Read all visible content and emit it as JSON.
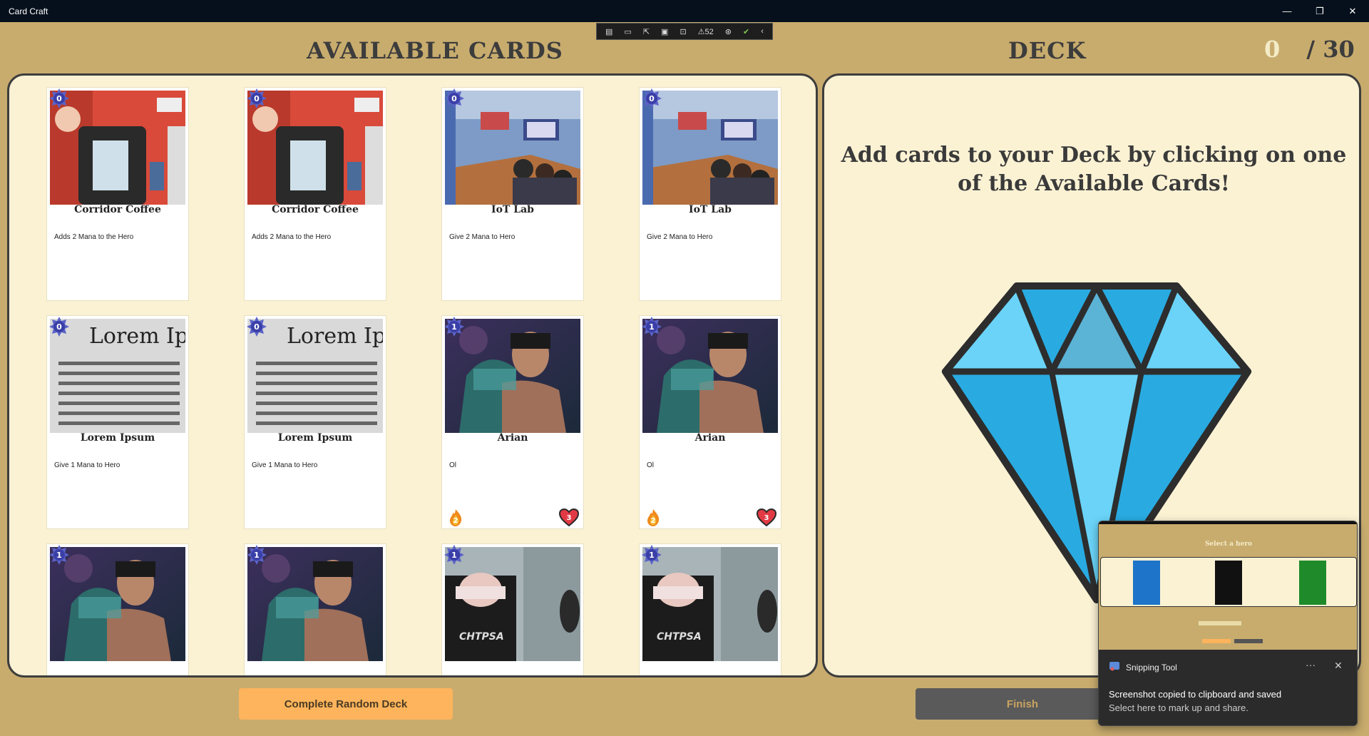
{
  "window": {
    "title": "Card Craft",
    "minimize_icon": "—",
    "restore_icon": "❐",
    "close_icon": "✕"
  },
  "devtools": {
    "counter": "52"
  },
  "available": {
    "title": "AVAILABLE CARDS"
  },
  "deck": {
    "title": "DECK",
    "count_current": "0",
    "count_separator": "/",
    "count_max": "30",
    "empty_message": "Add cards to your Deck by clicking on one of the Available Cards!"
  },
  "cards": [
    {
      "name": "Corridor Coffee",
      "desc": "Adds 2 Mana to the Hero",
      "cost": "0",
      "art": "coffee"
    },
    {
      "name": "Corridor Coffee",
      "desc": "Adds 2 Mana to the Hero",
      "cost": "0",
      "art": "coffee"
    },
    {
      "name": "IoT Lab",
      "desc": "Give 2 Mana to Hero",
      "cost": "0",
      "art": "lab"
    },
    {
      "name": "IoT Lab",
      "desc": "Give 2 Mana to Hero",
      "cost": "0",
      "art": "lab"
    },
    {
      "name": "Lorem Ipsum",
      "desc": "Give 1 Mana to Hero",
      "cost": "0",
      "art": "lorem",
      "art_heading": "Lorem Ips"
    },
    {
      "name": "Lorem Ipsum",
      "desc": "Give 1 Mana to Hero",
      "cost": "0",
      "art": "lorem",
      "art_heading": "Lorem Ips"
    },
    {
      "name": "Arian",
      "desc": "Ol",
      "cost": "1",
      "art": "hero",
      "attack": "2",
      "health": "3"
    },
    {
      "name": "Arian",
      "desc": "Ol",
      "cost": "1",
      "art": "hero",
      "attack": "2",
      "health": "3"
    },
    {
      "name": "",
      "desc": "",
      "cost": "1",
      "art": "hero"
    },
    {
      "name": "",
      "desc": "",
      "cost": "1",
      "art": "hero"
    },
    {
      "name": "",
      "desc": "",
      "cost": "1",
      "art": "photo",
      "art_caption": "CHTPSA"
    },
    {
      "name": "",
      "desc": "",
      "cost": "1",
      "art": "photo",
      "art_caption": "CHTPSA"
    }
  ],
  "buttons": {
    "random": "Complete Random Deck",
    "finish": "Finish"
  },
  "notification": {
    "app": "Snipping Tool",
    "more": "···",
    "close": "✕",
    "message": "Screenshot copied to clipboard and saved",
    "sub": "Select here to mark up and share.",
    "thumb_title": "Select a hero"
  },
  "colors": {
    "background": "#c8ac6e",
    "panel": "#fbf2d4",
    "random_button": "#fdb45c",
    "finish_button": "#5a5a5a",
    "diamond": "#29abe2"
  }
}
